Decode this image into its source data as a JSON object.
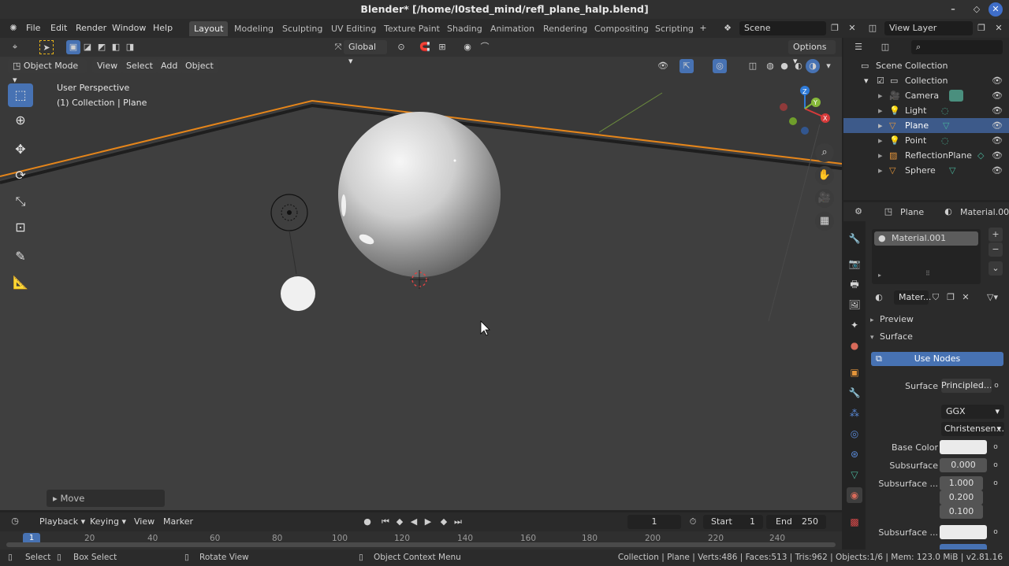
{
  "window": {
    "title": "Blender* [/home/l0sted_mind/refl_plane_halp.blend]"
  },
  "menu": {
    "items": [
      "File",
      "Edit",
      "Render",
      "Window",
      "Help"
    ]
  },
  "workspaces": [
    "Layout",
    "Modeling",
    "Sculpting",
    "UV Editing",
    "Texture Paint",
    "Shading",
    "Animation",
    "Rendering",
    "Compositing",
    "Scripting"
  ],
  "scene": {
    "name": "Scene",
    "view_layer": "View Layer"
  },
  "viewport": {
    "mode": "Object Mode",
    "menus": [
      "View",
      "Select",
      "Add",
      "Object"
    ],
    "transform_orientation": "Global",
    "options_label": "Options",
    "perspective_label": "User Perspective",
    "context_label": "(1) Collection | Plane",
    "last_op": "Move"
  },
  "timeline": {
    "menus": [
      "Playback",
      "Keying",
      "View",
      "Marker"
    ],
    "current_frame": "1",
    "start_label": "Start",
    "start": "1",
    "end_label": "End",
    "end": "250",
    "frames": [
      "1",
      "20",
      "40",
      "60",
      "80",
      "100",
      "120",
      "140",
      "160",
      "180",
      "200",
      "220",
      "240"
    ]
  },
  "status": {
    "select": "Select",
    "box_select": "Box Select",
    "rotate": "Rotate View",
    "context_menu": "Object Context Menu",
    "stats": "Collection | Plane | Verts:486 | Faces:513 | Tris:962 | Objects:1/6 | Mem: 123.0 MiB | v2.81.16"
  },
  "outliner": {
    "root": "Scene Collection",
    "collection": "Collection",
    "items": [
      {
        "name": "Camera"
      },
      {
        "name": "Light"
      },
      {
        "name": "Plane"
      },
      {
        "name": "Point"
      },
      {
        "name": "ReflectionPlane"
      },
      {
        "name": "Sphere"
      }
    ]
  },
  "properties": {
    "object": "Plane",
    "material_name": "Material.001",
    "slot": "Material.001",
    "material_short": "Mater...",
    "panels": {
      "preview": "Preview",
      "surface": "Surface"
    },
    "use_nodes": "Use Nodes",
    "surface_label": "Surface",
    "surface_value": "Principled...",
    "distribution": "GGX",
    "subsurface_method": "Christensen...",
    "base_color_label": "Base Color",
    "base_color": "#ebebeb",
    "subsurface_label": "Subsurface",
    "subsurface": "0.000",
    "subsurface_radius_label": "Subsurface ...",
    "radius": [
      "1.000",
      "0.200",
      "0.100"
    ],
    "subsurface_color_label": "Subsurface ..."
  },
  "colors": {
    "accent": "#4772b3",
    "selection": "#e5851a"
  }
}
